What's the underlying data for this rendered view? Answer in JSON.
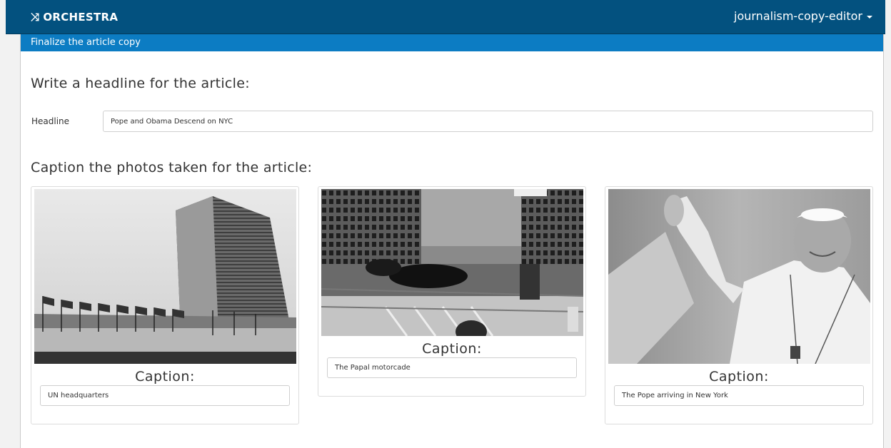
{
  "app": {
    "brand": "ORCHESTRA",
    "brand_icon": "shuffle-icon",
    "user_menu": "journalism-copy-editor"
  },
  "task": {
    "heading": "Finalize the article copy",
    "headline_prompt": "Write a headline for the article:",
    "headline_label": "Headline",
    "headline_value": "Pope and Obama Descend on NYC",
    "photos_prompt": "Caption the photos taken for the article:"
  },
  "photos": [
    {
      "caption_label": "Caption:",
      "caption_value": "UN headquarters"
    },
    {
      "caption_label": "Caption:",
      "caption_value": "The Papal motorcade"
    },
    {
      "caption_label": "Caption:",
      "caption_value": "The Pope arriving in New York"
    }
  ],
  "colors": {
    "navbar": "#03517f",
    "panel_heading": "#0c7cc3"
  }
}
